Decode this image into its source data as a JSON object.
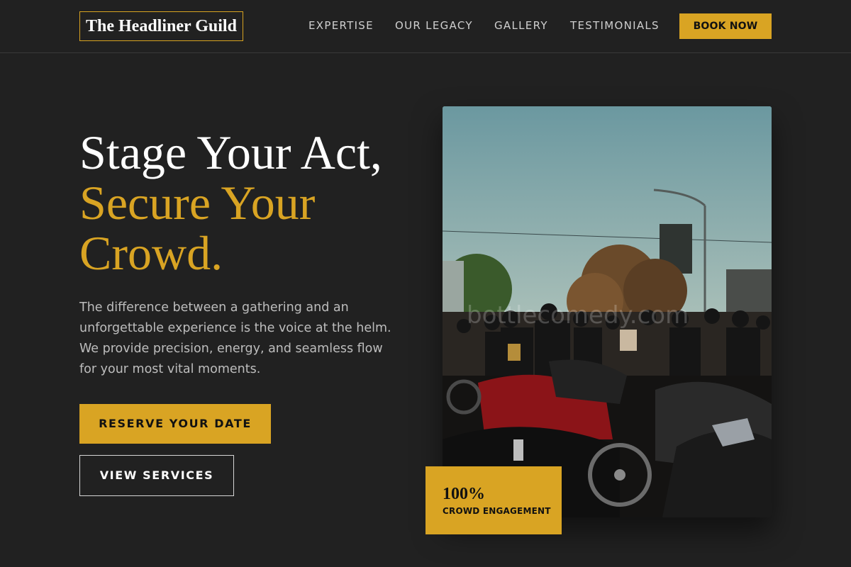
{
  "nav": {
    "logo": "The Headliner Guild",
    "links": [
      "EXPERTISE",
      "OUR LEGACY",
      "GALLERY",
      "TESTIMONIALS"
    ],
    "cta": "BOOK NOW"
  },
  "hero": {
    "title_line1": "Stage Your Act,",
    "title_line2": "Secure Your",
    "title_line3": "Crowd.",
    "description": "The difference between a gathering and an unforgettable experience is the voice at the helm. We provide precision, energy, and seamless flow for your most vital moments.",
    "primary_button": "RESERVE YOUR DATE",
    "secondary_button": "VIEW SERVICES"
  },
  "photo": {
    "watermark": "bottlecomedy.com"
  },
  "stat": {
    "value": "100%",
    "label": "CROWD ENGAGEMENT"
  },
  "colors": {
    "background": "#212121",
    "accent": "#d9a423",
    "text": "#ffffff",
    "muted_text": "#bdbdbd"
  }
}
